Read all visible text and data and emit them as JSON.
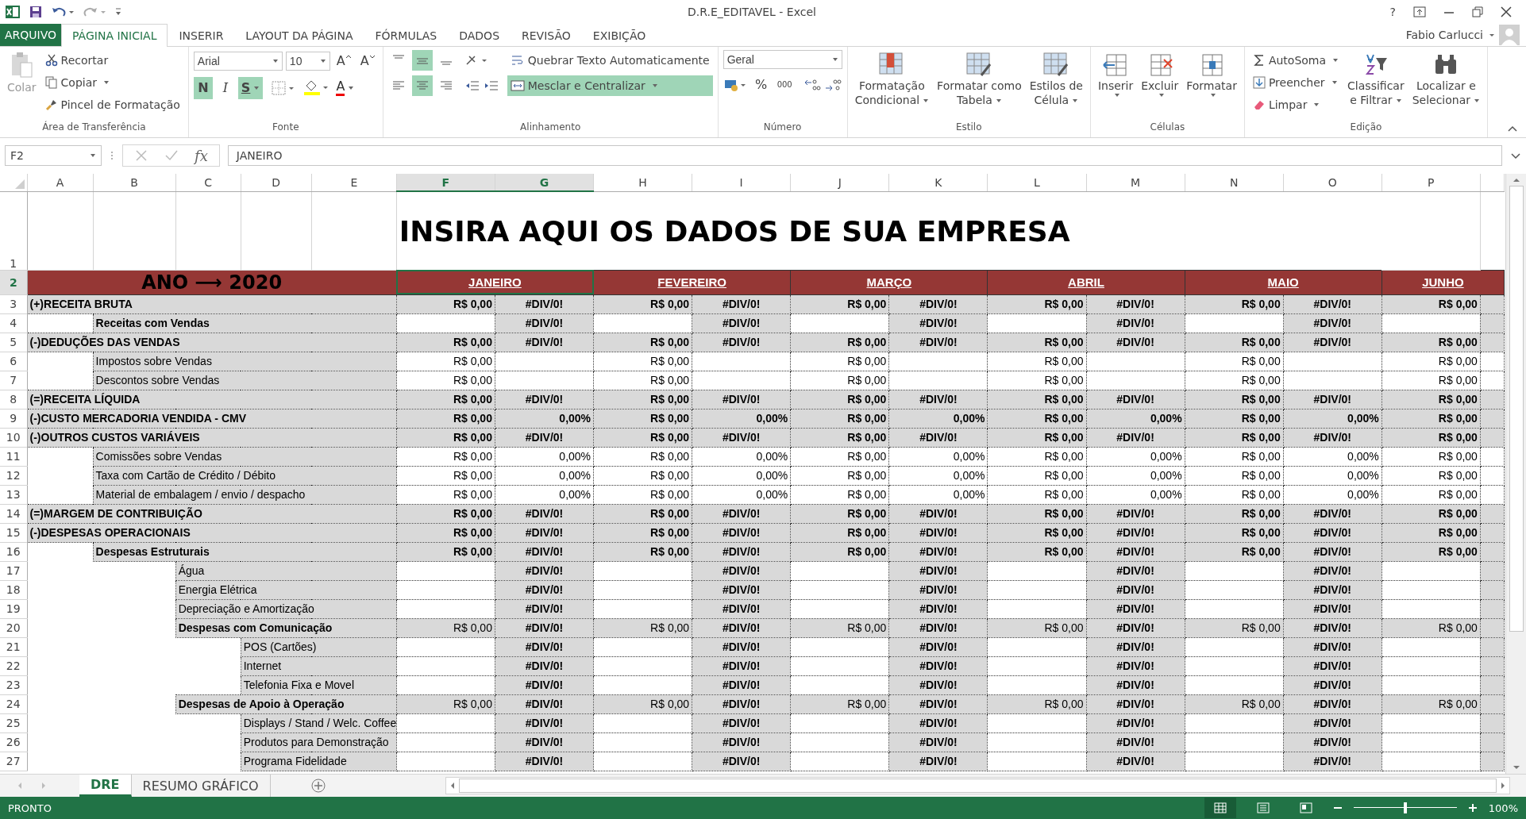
{
  "window": {
    "title": "D.R.E_EDITAVEL - Excel",
    "help": "?",
    "user": "Fabio Carlucci"
  },
  "ribbon_tabs": [
    {
      "label": "ARQUIVO",
      "kind": "file",
      "selected": false
    },
    {
      "label": "PÁGINA INICIAL",
      "kind": "tab",
      "selected": true
    },
    {
      "label": "INSERIR",
      "kind": "tab",
      "selected": false
    },
    {
      "label": "LAYOUT DA PÁGINA",
      "kind": "tab",
      "selected": false
    },
    {
      "label": "FÓRMULAS",
      "kind": "tab",
      "selected": false
    },
    {
      "label": "DADOS",
      "kind": "tab",
      "selected": false
    },
    {
      "label": "REVISÃO",
      "kind": "tab",
      "selected": false
    },
    {
      "label": "EXIBIÇÃO",
      "kind": "tab",
      "selected": false
    }
  ],
  "ribbon": {
    "clipboard": {
      "paste": "Colar",
      "cut": "Recortar",
      "copy": "Copiar",
      "painter": "Pincel de Formatação",
      "label": "Área de Transferência"
    },
    "font": {
      "family": "Arial",
      "size": "10",
      "grow": "A",
      "shrink": "A",
      "bold": {
        "label": "N",
        "on": true
      },
      "italic": {
        "label": "I",
        "on": false
      },
      "underline": {
        "label": "S",
        "on": true
      },
      "color_letter": "A",
      "label": "Fonte"
    },
    "alignment": {
      "vertical_align": [
        {
          "selected": false
        },
        {
          "selected": true
        },
        {
          "selected": false
        }
      ],
      "horizontal_align": [
        {
          "selected": false
        },
        {
          "selected": true
        },
        {
          "selected": false
        }
      ],
      "wrap": {
        "label": "Quebrar Texto Automaticamente",
        "on": false
      },
      "merge": {
        "label": "Mesclar e Centralizar",
        "on": true
      },
      "label": "Alinhamento"
    },
    "number": {
      "format": "Geral",
      "percent": "%",
      "thousands": "000",
      "label": "Número"
    },
    "styles": {
      "buttons": [
        {
          "lines": [
            "Formatação",
            "Condicional"
          ]
        },
        {
          "lines": [
            "Formatar como",
            "Tabela"
          ]
        },
        {
          "lines": [
            "Estilos de",
            "Célula"
          ]
        }
      ],
      "label": "Estilo"
    },
    "cells": {
      "buttons": [
        "Inserir",
        "Excluir",
        "Formatar"
      ],
      "label": "Células"
    },
    "editing": {
      "autosum": "AutoSoma",
      "fill": "Preencher",
      "clear": "Limpar",
      "buttons": [
        {
          "lines": [
            "Classificar",
            "e Filtrar"
          ]
        },
        {
          "lines": [
            "Localizar e",
            "Selecionar"
          ]
        }
      ],
      "label": "Edição"
    }
  },
  "formula_bar": {
    "name_box": "F2",
    "function_label": "fx",
    "formula": "JANEIRO"
  },
  "sheet": {
    "columns": [
      {
        "label": "A",
        "selected": false
      },
      {
        "label": "B",
        "selected": false
      },
      {
        "label": "C",
        "selected": false
      },
      {
        "label": "D",
        "selected": false
      },
      {
        "label": "E",
        "selected": false
      },
      {
        "label": "F",
        "selected": true
      },
      {
        "label": "G",
        "selected": true
      },
      {
        "label": "H",
        "selected": false
      },
      {
        "label": "I",
        "selected": false
      },
      {
        "label": "J",
        "selected": false
      },
      {
        "label": "K",
        "selected": false
      },
      {
        "label": "L",
        "selected": false
      },
      {
        "label": "M",
        "selected": false
      },
      {
        "label": "N",
        "selected": false
      },
      {
        "label": "O",
        "selected": false
      },
      {
        "label": "P",
        "selected": false
      }
    ],
    "header_rows": [
      {
        "number": "1",
        "selected": false
      },
      {
        "number": "2",
        "selected": true
      }
    ],
    "title": "INSIRA AQUI OS DADOS DE SUA EMPRESA",
    "year": "ANO ⟶ 2020",
    "months": [
      {
        "label": "JANEIRO",
        "selected": true
      },
      {
        "label": "FEVEREIRO",
        "selected": false
      },
      {
        "label": "MARÇO",
        "selected": false
      },
      {
        "label": "ABRIL",
        "selected": false
      },
      {
        "label": "MAIO",
        "selected": false
      },
      {
        "label": "JUNHO",
        "selected": false
      }
    ],
    "rows": [
      {
        "number": "3",
        "label": "(+)RECEITA BRUTA",
        "bold": true,
        "kind": "total",
        "ratio": false,
        "values": [
          "R$ 0,00",
          "R$ 0,00",
          "R$ 0,00",
          "R$ 0,00",
          "R$ 0,00",
          "R$ 0,00"
        ],
        "percents": [
          "#DIV/0!",
          "#DIV/0!",
          "#DIV/0!",
          "#DIV/0!",
          "#DIV/0!"
        ],
        "children": [
          {
            "number": "4",
            "label": "Receitas com Vendas",
            "bold": true,
            "kind": "entry",
            "ratio": false,
            "percents": [
              "#DIV/0!",
              "#DIV/0!",
              "#DIV/0!",
              "#DIV/0!",
              "#DIV/0!"
            ]
          }
        ]
      },
      {
        "number": "5",
        "label": "(-)DEDUÇÕES DAS VENDAS",
        "bold": true,
        "kind": "total",
        "ratio": false,
        "values": [
          "R$ 0,00",
          "R$ 0,00",
          "R$ 0,00",
          "R$ 0,00",
          "R$ 0,00",
          "R$ 0,00"
        ],
        "percents": [
          "#DIV/0!",
          "#DIV/0!",
          "#DIV/0!",
          "#DIV/0!",
          "#DIV/0!"
        ],
        "children": [
          {
            "number": "6",
            "label": "Impostos sobre Vendas",
            "bold": false,
            "kind": "input",
            "values": [
              "R$ 0,00",
              "R$ 0,00",
              "R$ 0,00",
              "R$ 0,00",
              "R$ 0,00",
              "R$ 0,00"
            ]
          },
          {
            "number": "7",
            "label": "Descontos sobre Vendas",
            "bold": false,
            "kind": "input",
            "values": [
              "R$ 0,00",
              "R$ 0,00",
              "R$ 0,00",
              "R$ 0,00",
              "R$ 0,00",
              "R$ 0,00"
            ]
          }
        ]
      },
      {
        "number": "8",
        "label": "(=)RECEITA LÍQUIDA",
        "bold": true,
        "kind": "total",
        "ratio": false,
        "values": [
          "R$ 0,00",
          "R$ 0,00",
          "R$ 0,00",
          "R$ 0,00",
          "R$ 0,00",
          "R$ 0,00"
        ],
        "percents": [
          "#DIV/0!",
          "#DIV/0!",
          "#DIV/0!",
          "#DIV/0!",
          "#DIV/0!"
        ]
      },
      {
        "number": "9",
        "label": "(-)CUSTO MERCADORIA VENDIDA - CMV",
        "bold": true,
        "kind": "total",
        "ratio": true,
        "values": [
          "R$ 0,00",
          "R$ 0,00",
          "R$ 0,00",
          "R$ 0,00",
          "R$ 0,00",
          "R$ 0,00"
        ],
        "percents": [
          "0,00%",
          "0,00%",
          "0,00%",
          "0,00%",
          "0,00%"
        ]
      },
      {
        "number": "10",
        "label": "(-)OUTROS CUSTOS VARIÁVEIS",
        "bold": true,
        "kind": "total",
        "ratio": false,
        "values": [
          "R$ 0,00",
          "R$ 0,00",
          "R$ 0,00",
          "R$ 0,00",
          "R$ 0,00",
          "R$ 0,00"
        ],
        "percents": [
          "#DIV/0!",
          "#DIV/0!",
          "#DIV/0!",
          "#DIV/0!",
          "#DIV/0!"
        ],
        "children": [
          {
            "number": "11",
            "label": "Comissões sobre Vendas",
            "bold": false,
            "kind": "input",
            "ratio": true,
            "values": [
              "R$ 0,00",
              "R$ 0,00",
              "R$ 0,00",
              "R$ 0,00",
              "R$ 0,00",
              "R$ 0,00"
            ],
            "percents": [
              "0,00%",
              "0,00%",
              "0,00%",
              "0,00%",
              "0,00%"
            ]
          },
          {
            "number": "12",
            "label": "Taxa com Cartão de Crédito / Débito",
            "bold": false,
            "kind": "input",
            "ratio": true,
            "values": [
              "R$ 0,00",
              "R$ 0,00",
              "R$ 0,00",
              "R$ 0,00",
              "R$ 0,00",
              "R$ 0,00"
            ],
            "percents": [
              "0,00%",
              "0,00%",
              "0,00%",
              "0,00%",
              "0,00%"
            ]
          },
          {
            "number": "13",
            "label": "Material de embalagem / envio / despacho",
            "bold": false,
            "kind": "input",
            "ratio": true,
            "values": [
              "R$ 0,00",
              "R$ 0,00",
              "R$ 0,00",
              "R$ 0,00",
              "R$ 0,00",
              "R$ 0,00"
            ],
            "percents": [
              "0,00%",
              "0,00%",
              "0,00%",
              "0,00%",
              "0,00%"
            ]
          }
        ]
      },
      {
        "number": "14",
        "label": "(=)MARGEM DE CONTRIBUIÇÃO",
        "bold": true,
        "kind": "total",
        "ratio": false,
        "values": [
          "R$ 0,00",
          "R$ 0,00",
          "R$ 0,00",
          "R$ 0,00",
          "R$ 0,00",
          "R$ 0,00"
        ],
        "percents": [
          "#DIV/0!",
          "#DIV/0!",
          "#DIV/0!",
          "#DIV/0!",
          "#DIV/0!"
        ]
      },
      {
        "number": "15",
        "label": "(-)DESPESAS OPERACIONAIS",
        "bold": true,
        "kind": "total",
        "ratio": false,
        "values": [
          "R$ 0,00",
          "R$ 0,00",
          "R$ 0,00",
          "R$ 0,00",
          "R$ 0,00",
          "R$ 0,00"
        ],
        "percents": [
          "#DIV/0!",
          "#DIV/0!",
          "#DIV/0!",
          "#DIV/0!",
          "#DIV/0!"
        ],
        "children": [
          {
            "number": "16",
            "label": "Despesas Estruturais",
            "bold": true,
            "kind": "total",
            "ratio": false,
            "values": [
              "R$ 0,00",
              "R$ 0,00",
              "R$ 0,00",
              "R$ 0,00",
              "R$ 0,00",
              "R$ 0,00"
            ],
            "percents": [
              "#DIV/0!",
              "#DIV/0!",
              "#DIV/0!",
              "#DIV/0!",
              "#DIV/0!"
            ],
            "children": [
              {
                "number": "17",
                "label": "Água",
                "bold": false,
                "kind": "entry",
                "ratio": false,
                "percents": [
                  "#DIV/0!",
                  "#DIV/0!",
                  "#DIV/0!",
                  "#DIV/0!",
                  "#DIV/0!"
                ]
              },
              {
                "number": "18",
                "label": "Energia Elétrica",
                "bold": false,
                "kind": "entry",
                "ratio": false,
                "percents": [
                  "#DIV/0!",
                  "#DIV/0!",
                  "#DIV/0!",
                  "#DIV/0!",
                  "#DIV/0!"
                ]
              },
              {
                "number": "19",
                "label": "Depreciação e Amortização",
                "bold": false,
                "kind": "entry",
                "ratio": false,
                "percents": [
                  "#DIV/0!",
                  "#DIV/0!",
                  "#DIV/0!",
                  "#DIV/0!",
                  "#DIV/0!"
                ]
              },
              {
                "number": "20",
                "label": "Despesas com Comunicação",
                "bold": true,
                "kind": "subtotal",
                "ratio": false,
                "values": [
                  "R$ 0,00",
                  "R$ 0,00",
                  "R$ 0,00",
                  "R$ 0,00",
                  "R$ 0,00",
                  "R$ 0,00"
                ],
                "percents": [
                  "#DIV/0!",
                  "#DIV/0!",
                  "#DIV/0!",
                  "#DIV/0!",
                  "#DIV/0!"
                ],
                "children": [
                  {
                    "number": "21",
                    "label": "POS (Cartões)",
                    "bold": false,
                    "kind": "entry",
                    "ratio": false,
                    "percents": [
                      "#DIV/0!",
                      "#DIV/0!",
                      "#DIV/0!",
                      "#DIV/0!",
                      "#DIV/0!"
                    ]
                  },
                  {
                    "number": "22",
                    "label": "Internet",
                    "bold": false,
                    "kind": "entry",
                    "ratio": false,
                    "percents": [
                      "#DIV/0!",
                      "#DIV/0!",
                      "#DIV/0!",
                      "#DIV/0!",
                      "#DIV/0!"
                    ]
                  },
                  {
                    "number": "23",
                    "label": "Telefonia Fixa e Movel",
                    "bold": false,
                    "kind": "entry",
                    "ratio": false,
                    "percents": [
                      "#DIV/0!",
                      "#DIV/0!",
                      "#DIV/0!",
                      "#DIV/0!",
                      "#DIV/0!"
                    ]
                  }
                ]
              },
              {
                "number": "24",
                "label": "Despesas de Apoio à Operação",
                "bold": true,
                "kind": "subtotal",
                "ratio": false,
                "values": [
                  "R$ 0,00",
                  "R$ 0,00",
                  "R$ 0,00",
                  "R$ 0,00",
                  "R$ 0,00",
                  "R$ 0,00"
                ],
                "percents": [
                  "#DIV/0!",
                  "#DIV/0!",
                  "#DIV/0!",
                  "#DIV/0!",
                  "#DIV/0!"
                ],
                "children": [
                  {
                    "number": "25",
                    "label": "Displays / Stand / Welc. Coffee",
                    "bold": false,
                    "kind": "entry",
                    "ratio": false,
                    "percents": [
                      "#DIV/0!",
                      "#DIV/0!",
                      "#DIV/0!",
                      "#DIV/0!",
                      "#DIV/0!"
                    ]
                  },
                  {
                    "number": "26",
                    "label": "Produtos para Demonstração",
                    "bold": false,
                    "kind": "entry",
                    "ratio": false,
                    "percents": [
                      "#DIV/0!",
                      "#DIV/0!",
                      "#DIV/0!",
                      "#DIV/0!",
                      "#DIV/0!"
                    ]
                  },
                  {
                    "number": "27",
                    "label": "Programa Fidelidade",
                    "bold": false,
                    "kind": "entry",
                    "ratio": false,
                    "percents": [
                      "#DIV/0!",
                      "#DIV/0!",
                      "#DIV/0!",
                      "#DIV/0!",
                      "#DIV/0!"
                    ]
                  }
                ]
              }
            ]
          }
        ]
      }
    ]
  },
  "sheet_tabs": [
    {
      "label": "DRE",
      "selected": true
    },
    {
      "label": "RESUMO GRÁFICO",
      "selected": false
    }
  ],
  "status_bar": {
    "status": "PRONTO",
    "views": [
      {
        "selected": true
      },
      {
        "selected": false
      },
      {
        "selected": false
      }
    ],
    "zoom": {
      "level": 0.5,
      "reading": "100%"
    }
  }
}
